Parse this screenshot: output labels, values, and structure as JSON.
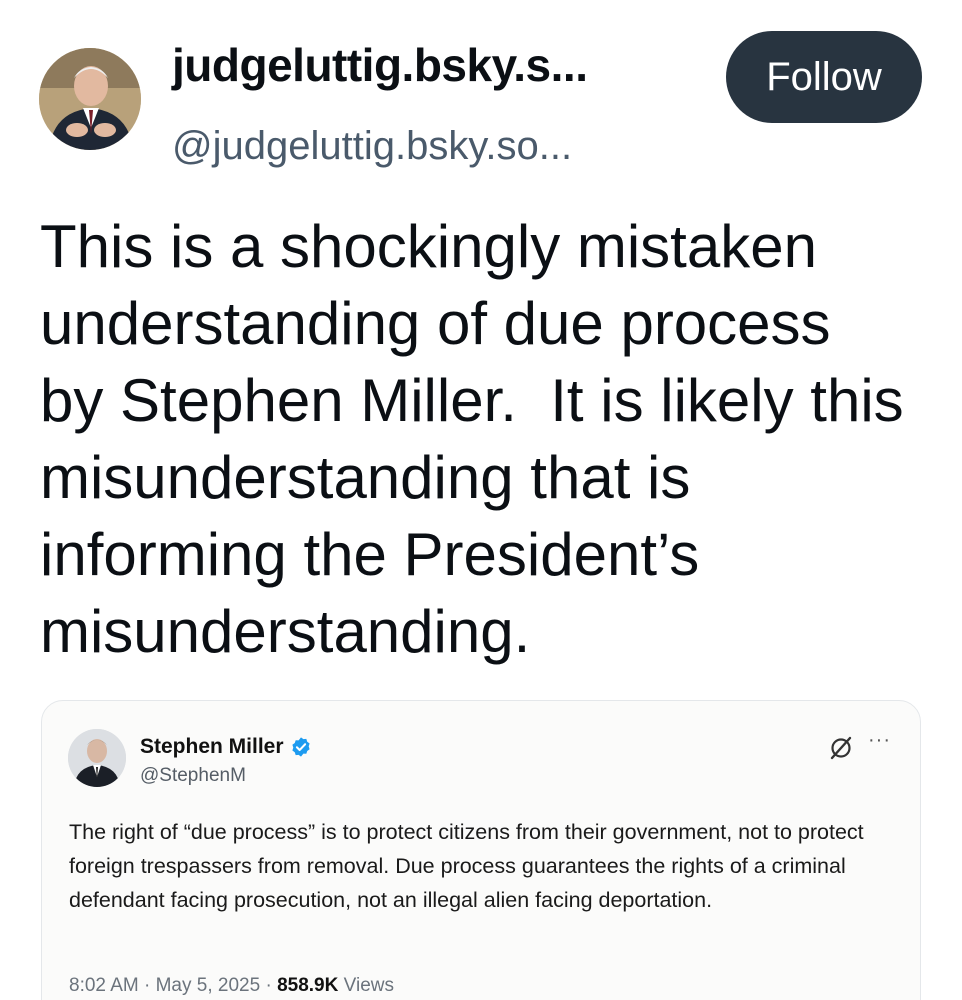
{
  "post": {
    "author": {
      "display_name": "judgeluttig.bsky.s...",
      "handle": "@judgeluttig.bsky.so..."
    },
    "follow_label": "Follow",
    "text": "This is a shockingly mistaken\nunderstanding of due process\nby Stephen Miller.  It is likely this\nmisunderstanding that is\ninforming the President’s\nmisunderstanding."
  },
  "embed": {
    "author": {
      "display_name": "Stephen Miller",
      "handle": "@StephenM"
    },
    "icons": [
      "avatar",
      "verified-badge-icon",
      "grok-icon",
      "more-icon"
    ],
    "text": "The right of “due process” is to protect citizens from their government, not to protect foreign trespassers from removal. Due process guarantees the rights of a criminal defendant facing prosecution, not an illegal alien facing deportation.",
    "time": "8:02 AM",
    "date": "May 5, 2025",
    "views_count": "858.9K",
    "views_label": "Views",
    "separator": " · "
  },
  "colors": {
    "follow_bg": "#283440",
    "handle": "#4a5a6b",
    "verified": "#1d9bf0"
  }
}
